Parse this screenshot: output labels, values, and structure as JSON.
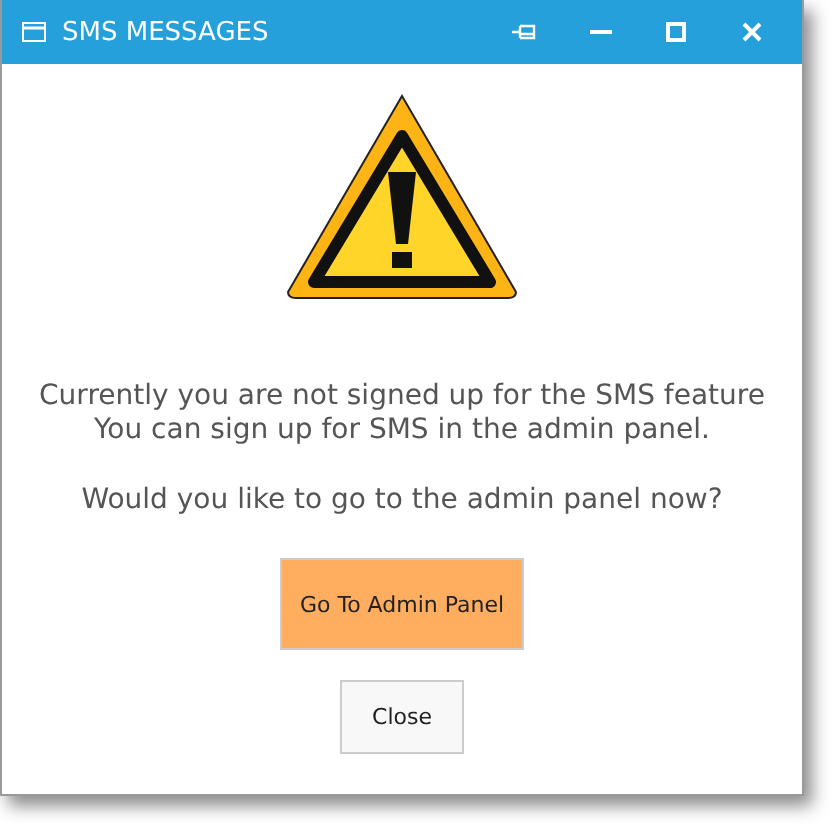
{
  "window": {
    "title": "SMS MESSAGES"
  },
  "message": {
    "lines": [
      "Currently you are not signed up for the SMS feature",
      "You can sign up for SMS in the admin panel."
    ],
    "question": "Would you like to go to the admin panel now?"
  },
  "buttons": [
    {
      "label": "Go To Admin Panel",
      "kind": "primary"
    },
    {
      "label": "Close",
      "kind": "secondary"
    }
  ]
}
